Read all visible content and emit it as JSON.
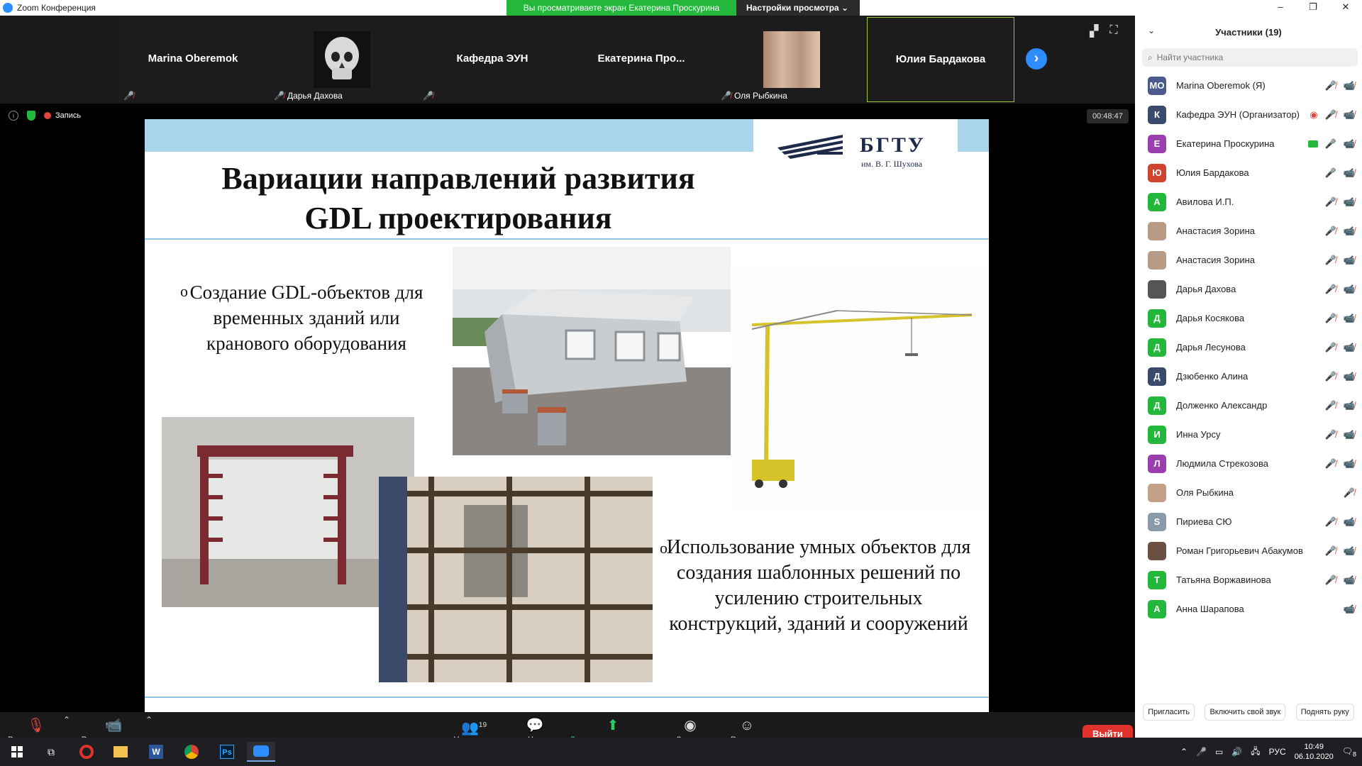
{
  "window": {
    "title": "Zoom Конференция"
  },
  "banner": {
    "viewing": "Вы просматриваете экран Екатерина Проскурина",
    "settings": "Настройки просмотра ⌄"
  },
  "thumbs": [
    {
      "name": "Marina Oberemok",
      "label": ""
    },
    {
      "name": "",
      "label": "Дарья Дахова"
    },
    {
      "name": "Кафедра ЭУН",
      "label": ""
    },
    {
      "name": "Екатерина  Про...",
      "label": ""
    },
    {
      "name": "",
      "label": "Оля Рыбкина"
    },
    {
      "name": "Юлия Бардакова",
      "label": ""
    }
  ],
  "status": {
    "recording": "Запись",
    "timer": "00:48:47"
  },
  "slide": {
    "title_line1": "Вариации направлений развития",
    "title_line2": "GDL проектирования",
    "logo": "БГТУ",
    "logo_sub": "им. В. Г. Шухова",
    "bullet1": "Создание GDL-объектов для временных зданий или кранового оборудования",
    "bullet2": "Использование умных объектов для создания шаблонных решений по усилению строительных конструкций, зданий и сооружений",
    "bullet_marker": "o"
  },
  "toolbar": {
    "audio": "Включить звук",
    "video": "Включить видео",
    "participants": "Участники",
    "participants_count": "19",
    "chat": "Чат",
    "share": "Демонстрация экрана",
    "record": "Запись",
    "reactions": "Реакции",
    "exit": "Выйти"
  },
  "panel": {
    "title": "Участники (19)",
    "search_placeholder": "Найти участника",
    "participants": [
      {
        "initials": "MO",
        "name": "Marina Oberemok (Я)",
        "color": "#4a5a8c"
      },
      {
        "initials": "К",
        "name": "Кафедра ЭУН (Организатор)",
        "color": "#3a4a6c"
      },
      {
        "initials": "Е",
        "name": "Екатерина Проскурина",
        "color": "#9b3fb0"
      },
      {
        "initials": "Ю",
        "name": "Юлия Бардакова",
        "color": "#d0432f"
      },
      {
        "initials": "А",
        "name": "Авилова И.П.",
        "color": "#23b83b"
      },
      {
        "initials": "",
        "name": "Анастасия Зорина",
        "color": "#b99a86"
      },
      {
        "initials": "",
        "name": "Анастасия Зорина",
        "color": "#b99a86"
      },
      {
        "initials": "",
        "name": "Дарья Дахова",
        "color": "#555555"
      },
      {
        "initials": "Д",
        "name": "Дарья Косякова",
        "color": "#23b83b"
      },
      {
        "initials": "Д",
        "name": "Дарья Лесунова",
        "color": "#23b83b"
      },
      {
        "initials": "Д",
        "name": "Дзюбенко Алина",
        "color": "#3a4a6c"
      },
      {
        "initials": "Д",
        "name": "Долженко Александр",
        "color": "#23b83b"
      },
      {
        "initials": "И",
        "name": "Инна Урсу",
        "color": "#23b83b"
      },
      {
        "initials": "Л",
        "name": "Людмила Стрекозова",
        "color": "#9b3fb0"
      },
      {
        "initials": "",
        "name": "Оля Рыбкина",
        "color": "#c4a088"
      },
      {
        "initials": "S",
        "name": "Пириева СЮ",
        "color": "#8a9aa8"
      },
      {
        "initials": "",
        "name": "Роман Григорьевич Абакумов",
        "color": "#6a5040"
      },
      {
        "initials": "Т",
        "name": "Татьяна Воржавинова",
        "color": "#23b83b"
      },
      {
        "initials": "А",
        "name": "Анна Шарапова",
        "color": "#23b83b"
      }
    ],
    "invite": "Пригласить",
    "unmute_self": "Включить свой звук",
    "raise_hand": "Поднять руку"
  },
  "taskbar": {
    "lang": "РУС",
    "time": "10:49",
    "date": "06.10.2020",
    "notif_count": "8"
  },
  "colors": {
    "accent": "#2d8cff",
    "green": "#23b83b",
    "red": "#e0483d",
    "slide_band": "#a9d4ec"
  }
}
